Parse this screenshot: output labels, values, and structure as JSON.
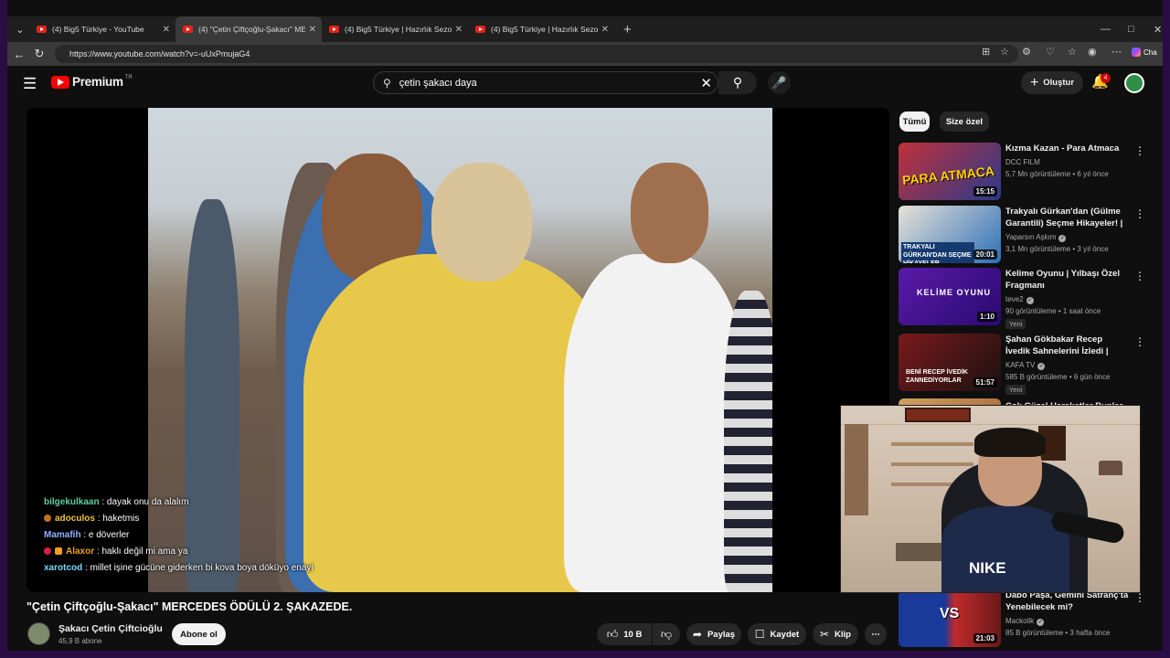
{
  "browser": {
    "tabs": [
      {
        "label": "(4) Big5 Türkiye - YouTube",
        "active": false
      },
      {
        "label": "(4) \"Çetin Çiftçoğlu-Şakacı\" MERCEDES ÖDÜLÜ",
        "active": true
      },
      {
        "label": "(4) Big5 Türkiye | Hazırlık Sezonu 1",
        "active": false
      },
      {
        "label": "(4) Big5 Türkiye | Hazırlık Sezonu 1",
        "active": false
      }
    ],
    "url": "https://www.youtube.com/watch?v=-uUxPmujaG4",
    "copilot_label": "Cha"
  },
  "youtube": {
    "logo_text": "Premium",
    "logo_region": "TR",
    "search_query": "çetin şakacı daya",
    "create_label": "Oluştur",
    "notification_count": "4"
  },
  "video": {
    "title": "\"Çetin Çiftçoğlu-Şakacı\" MERCEDES ÖDÜLÜ 2. ŞAKAZEDE.",
    "channel": "Şakacı Çetin Çiftcioğlu",
    "subscribers": "45,9 B abone",
    "subscribe_label": "Abone ol",
    "likes": "10 B",
    "share_label": "Paylaş",
    "save_label": "Kaydet",
    "clip_label": "Klip"
  },
  "chat": [
    {
      "user": "bilgekulkaan",
      "message": ": dayak onu da alalım",
      "color": "#5fcfa0",
      "badge": ""
    },
    {
      "user": "adoculos",
      "message": ": haketmis",
      "color": "#f0c040",
      "badge": "#c07020"
    },
    {
      "user": "Mamafih",
      "message": ": e döverler",
      "color": "#8fb4ff",
      "badge": ""
    },
    {
      "user": "Alaxor",
      "message": ": haklı değil mi ama ya",
      "color": "#f0a020",
      "badge": "#d02040"
    },
    {
      "user": "xarotcod",
      "message": ": millet işine gücüne giderken bi kova boya döküyo enayi",
      "color": "#7ad7ff",
      "badge": ""
    }
  ],
  "sidebar": {
    "chips": [
      "Tümü",
      "Size özel"
    ],
    "items": [
      {
        "title": "Kızma Kazan - Para Atmaca",
        "channel": "DCC FILM",
        "verified": false,
        "meta": "5,7 Mn görüntüleme • 6 yıl önce",
        "duration": "15:15",
        "new": "",
        "thumb_a": "#c0303a",
        "thumb_b": "#2a3a8a",
        "thumb_text": "PARA ATMACA"
      },
      {
        "title": "Trakyalı Gürkan'dan (Gülme Garantili) Seçme Hikayeler! | ...",
        "channel": "Yaparsın Aşkım",
        "verified": true,
        "meta": "3,1 Mn görüntüleme • 3 yıl önce",
        "duration": "20:01",
        "new": "",
        "thumb_a": "#2d6fb8",
        "thumb_b": "#e8e2d8",
        "thumb_text": "TRAKYALI GÜRKAN'DAN SEÇME HİKAYELER"
      },
      {
        "title": "Kelime Oyunu | Yılbaşı Özel Fragmanı",
        "channel": "teve2",
        "verified": true,
        "meta": "90 görüntüleme • 1 saat önce",
        "duration": "1:10",
        "new": "Yeni",
        "thumb_a": "#5a1aa8",
        "thumb_b": "#2a0a70",
        "thumb_text": "KELİME OYUNU"
      },
      {
        "title": "Şahan Gökbakar Recep İvedik Sahnelerini İzledi | Fenomen ...",
        "channel": "KAFA TV",
        "verified": true,
        "meta": "585 B görüntüleme • 6 gün önce",
        "duration": "51:57",
        "new": "Yeni",
        "thumb_a": "#7a1a1a",
        "thumb_b": "#1a1010",
        "thumb_text": "BENİ RECEP İVEDİK ZANNEDİYORLAR"
      },
      {
        "title": "Çok Güzel Hareketler Bunlar 66...",
        "channel": "",
        "verified": false,
        "meta": "",
        "duration": "",
        "new": "",
        "thumb_a": "#d0a060",
        "thumb_b": "#a06030",
        "thumb_text": ""
      },
      {
        "title": "Dabo Paşa, Gemini Satranç'ta Yenebilecek mi?",
        "channel": "Mackolik",
        "verified": true,
        "meta": "85 B görüntüleme • 3 hafta önce",
        "duration": "21:03",
        "new": "",
        "thumb_a": "#1a3a9a",
        "thumb_b": "#c02a2a",
        "thumb_text": "VS"
      }
    ]
  }
}
